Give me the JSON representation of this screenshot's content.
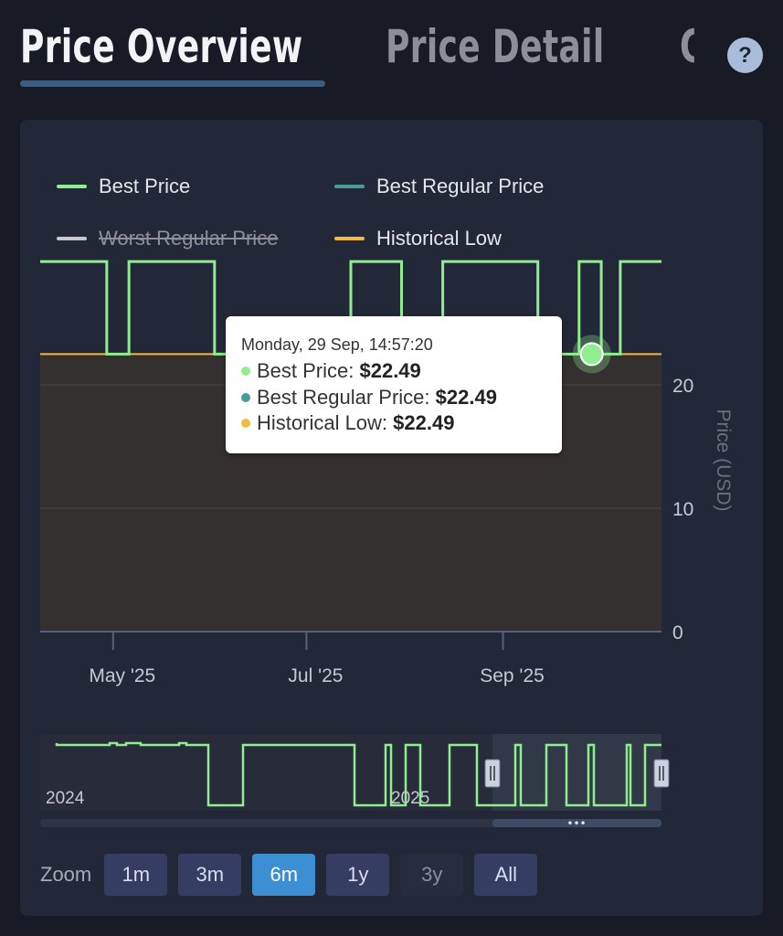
{
  "tabs": [
    {
      "label": "Price Overview",
      "active": true
    },
    {
      "label": "Price Detail",
      "active": false
    },
    {
      "label": "C",
      "active": false
    }
  ],
  "help_label": "?",
  "legend": [
    {
      "label": "Best Price",
      "color": "#90ee90",
      "visible": true
    },
    {
      "label": "Best Regular Price",
      "color": "#4a9a9a",
      "visible": true
    },
    {
      "label": "Worst Regular Price",
      "color": "#c8c8c8",
      "visible": false
    },
    {
      "label": "Historical Low",
      "color": "#f4b942",
      "visible": true
    }
  ],
  "tooltip": {
    "header": "Monday, 29 Sep, 14:57:20",
    "rows": [
      {
        "label": "Best Price: ",
        "value": "$22.49",
        "color": "#90ee90"
      },
      {
        "label": "Best Regular Price: ",
        "value": "$22.49",
        "color": "#4a9a9a"
      },
      {
        "label": "Historical Low: ",
        "value": "$22.49",
        "color": "#f4b942"
      }
    ]
  },
  "chart_data": {
    "type": "line",
    "step": true,
    "x_range": [
      "2025-04-08",
      "2025-10-21"
    ],
    "ylim": [
      0,
      30
    ],
    "ylabel": "Price (USD)",
    "y_ticks": [
      0,
      10,
      20
    ],
    "x_ticks": [
      {
        "date": "2025-05-01",
        "label": "May '25"
      },
      {
        "date": "2025-07-01",
        "label": "Jul '25"
      },
      {
        "date": "2025-09-01",
        "label": "Sep '25"
      }
    ],
    "grid": true,
    "legend_position": "top",
    "series": [
      {
        "name": "Best Price",
        "color": "#90ee90",
        "points": [
          [
            "2025-04-08",
            29.99
          ],
          [
            "2025-04-29",
            22.49
          ],
          [
            "2025-05-06",
            29.99
          ],
          [
            "2025-06-02",
            22.49
          ],
          [
            "2025-07-15",
            29.99
          ],
          [
            "2025-07-31",
            22.49
          ],
          [
            "2025-08-13",
            29.99
          ],
          [
            "2025-09-12",
            22.49
          ],
          [
            "2025-09-25",
            29.99
          ],
          [
            "2025-10-02",
            22.49
          ],
          [
            "2025-10-08",
            29.99
          ],
          [
            "2025-10-21",
            29.99
          ]
        ]
      },
      {
        "name": "Historical Low",
        "color": "#f4b942",
        "points": [
          [
            "2025-04-08",
            22.49
          ],
          [
            "2025-10-21",
            22.49
          ]
        ]
      }
    ],
    "highlight": {
      "date": "2025-09-29",
      "value": 22.49
    },
    "navigator": {
      "labels": [
        "2024",
        "2025"
      ],
      "selection": [
        "2025-04-08",
        "2025-10-21"
      ]
    }
  },
  "zoom": {
    "label": "Zoom",
    "buttons": [
      {
        "label": "1m",
        "state": "normal"
      },
      {
        "label": "3m",
        "state": "normal"
      },
      {
        "label": "6m",
        "state": "active"
      },
      {
        "label": "1y",
        "state": "normal"
      },
      {
        "label": "3y",
        "state": "disabled"
      },
      {
        "label": "All",
        "state": "normal"
      }
    ]
  }
}
